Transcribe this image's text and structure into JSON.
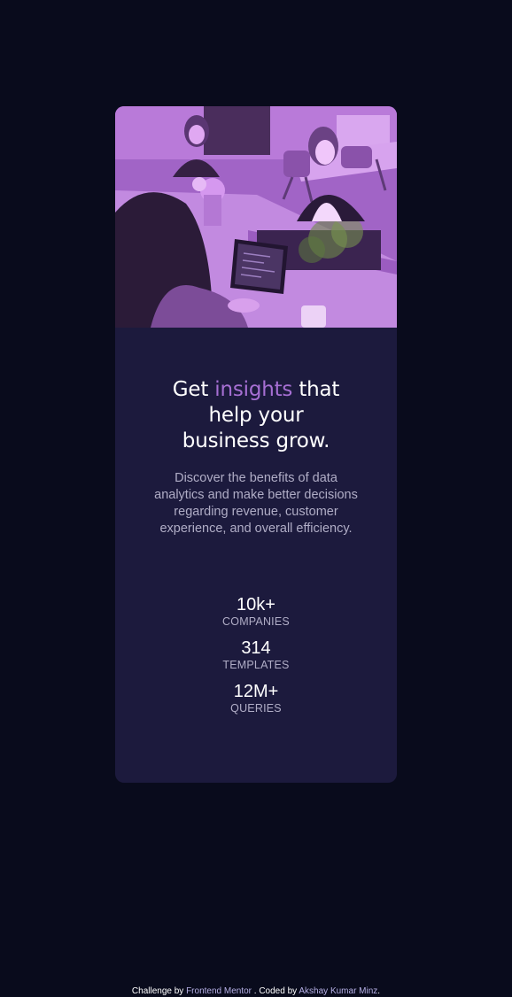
{
  "hero": {
    "alt": "Team working in an office"
  },
  "headline": {
    "pre": "Get ",
    "accent": "insights",
    "post": " that",
    "line2": "help your",
    "line3": "business grow."
  },
  "description": "Discover the benefits of data analytics and make better decisions regarding revenue, customer experience, and overall efficiency.",
  "stats": [
    {
      "value": "10k+",
      "label": "COMPANIES"
    },
    {
      "value": "314",
      "label": "TEMPLATES"
    },
    {
      "value": "12M+",
      "label": "QUERIES"
    }
  ],
  "footer": {
    "prefix": "Challenge by ",
    "challenge_link": "Frontend Mentor",
    "middle": " . Coded by ",
    "author_link": "Akshay Kumar Minz",
    "suffix": "."
  },
  "colors": {
    "page_background": "#090b1c",
    "card_background": "#1c1a3d",
    "accent": "#a66fd3",
    "image_tint": "#a365c9",
    "text_primary": "#ffffff",
    "text_secondary": "#b0adc6"
  }
}
